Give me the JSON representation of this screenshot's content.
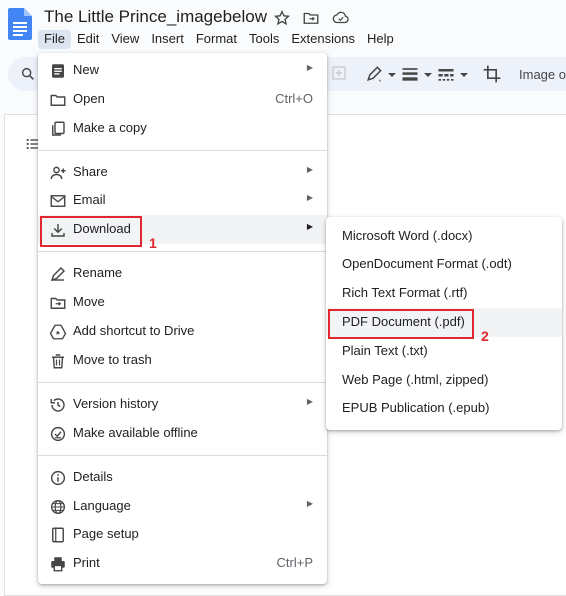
{
  "document": {
    "title": "The Little Prince_imagebelow"
  },
  "menubar": {
    "items": [
      "File",
      "Edit",
      "View",
      "Insert",
      "Format",
      "Tools",
      "Extensions",
      "Help"
    ],
    "active": "File"
  },
  "toolbar": {
    "image_label": "Image o"
  },
  "file_menu": {
    "items": [
      {
        "label": "New",
        "icon": "new-doc-icon",
        "submenu": true
      },
      {
        "label": "Open",
        "icon": "folder-open-icon",
        "shortcut": "Ctrl+O"
      },
      {
        "label": "Make a copy",
        "icon": "copy-icon"
      },
      {
        "label": "Share",
        "icon": "share-person-icon",
        "submenu": true
      },
      {
        "label": "Email",
        "icon": "mail-icon",
        "submenu": true
      },
      {
        "label": "Download",
        "icon": "download-icon",
        "submenu": true,
        "highlighted": true
      },
      {
        "label": "Rename",
        "icon": "rename-pen-icon"
      },
      {
        "label": "Move",
        "icon": "move-folder-icon"
      },
      {
        "label": "Add shortcut to Drive",
        "icon": "drive-shortcut-icon"
      },
      {
        "label": "Move to trash",
        "icon": "trash-icon"
      },
      {
        "label": "Version history",
        "icon": "history-icon",
        "submenu": true
      },
      {
        "label": "Make available offline",
        "icon": "offline-icon"
      },
      {
        "label": "Details",
        "icon": "info-icon"
      },
      {
        "label": "Language",
        "icon": "globe-icon",
        "submenu": true
      },
      {
        "label": "Page setup",
        "icon": "page-setup-icon"
      },
      {
        "label": "Print",
        "icon": "print-icon",
        "shortcut": "Ctrl+P"
      }
    ]
  },
  "download_submenu": {
    "items": [
      {
        "label": "Microsoft Word (.docx)"
      },
      {
        "label": "OpenDocument Format (.odt)"
      },
      {
        "label": "Rich Text Format (.rtf)"
      },
      {
        "label": "PDF Document (.pdf)",
        "highlighted": true
      },
      {
        "label": "Plain Text (.txt)"
      },
      {
        "label": "Web Page (.html, zipped)"
      },
      {
        "label": "EPUB Publication (.epub)"
      }
    ]
  },
  "annotations": {
    "step1": "1",
    "step2": "2",
    "color": "#e0262e"
  },
  "colors": {
    "docs_blue": "#4285f4",
    "menu_highlight": "#f1f3f4",
    "toolbar_bg": "#edf2fa"
  }
}
